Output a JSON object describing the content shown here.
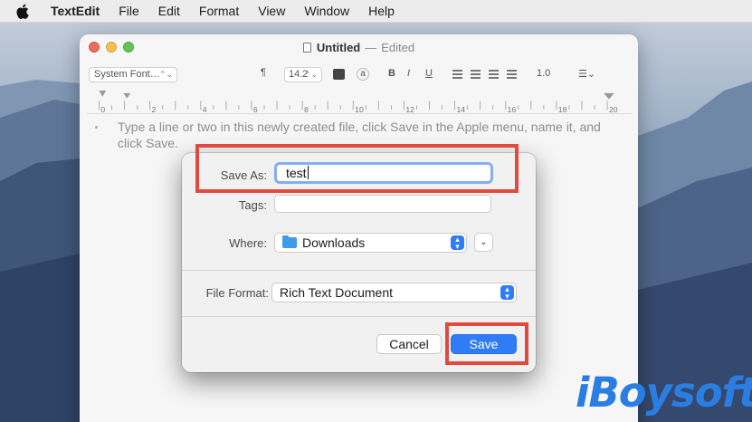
{
  "menubar": {
    "app_name": "TextEdit",
    "items": [
      "File",
      "Edit",
      "Format",
      "View",
      "Window",
      "Help"
    ]
  },
  "window": {
    "title": "Untitled",
    "separator": "—",
    "status": "Edited",
    "toolbar": {
      "font": "System Font…",
      "size": "14.2",
      "text_color_swatch": "a",
      "bold": "B",
      "italic": "I",
      "underline": "U",
      "spacing": "1.0",
      "list_icon": "list-bullet-icon"
    },
    "ruler_labels": [
      "0",
      "2",
      "4",
      "6",
      "8",
      "10",
      "12",
      "14",
      "16",
      "18",
      "20"
    ],
    "document_text": "Type a line or two in this newly created file, click Save in the Apple menu, name it, and click Save."
  },
  "dialog": {
    "save_as_label": "Save As:",
    "save_as_value": "test",
    "tags_label": "Tags:",
    "tags_value": "",
    "where_label": "Where:",
    "where_value": "Downloads",
    "file_format_label": "File Format:",
    "file_format_value": "Rich Text Document",
    "cancel_label": "Cancel",
    "save_label": "Save"
  },
  "watermark": "iBoysoft",
  "colors": {
    "accent": "#2f7cf6",
    "highlight_box": "#e04b3d",
    "watermark": "#2a7de1"
  }
}
